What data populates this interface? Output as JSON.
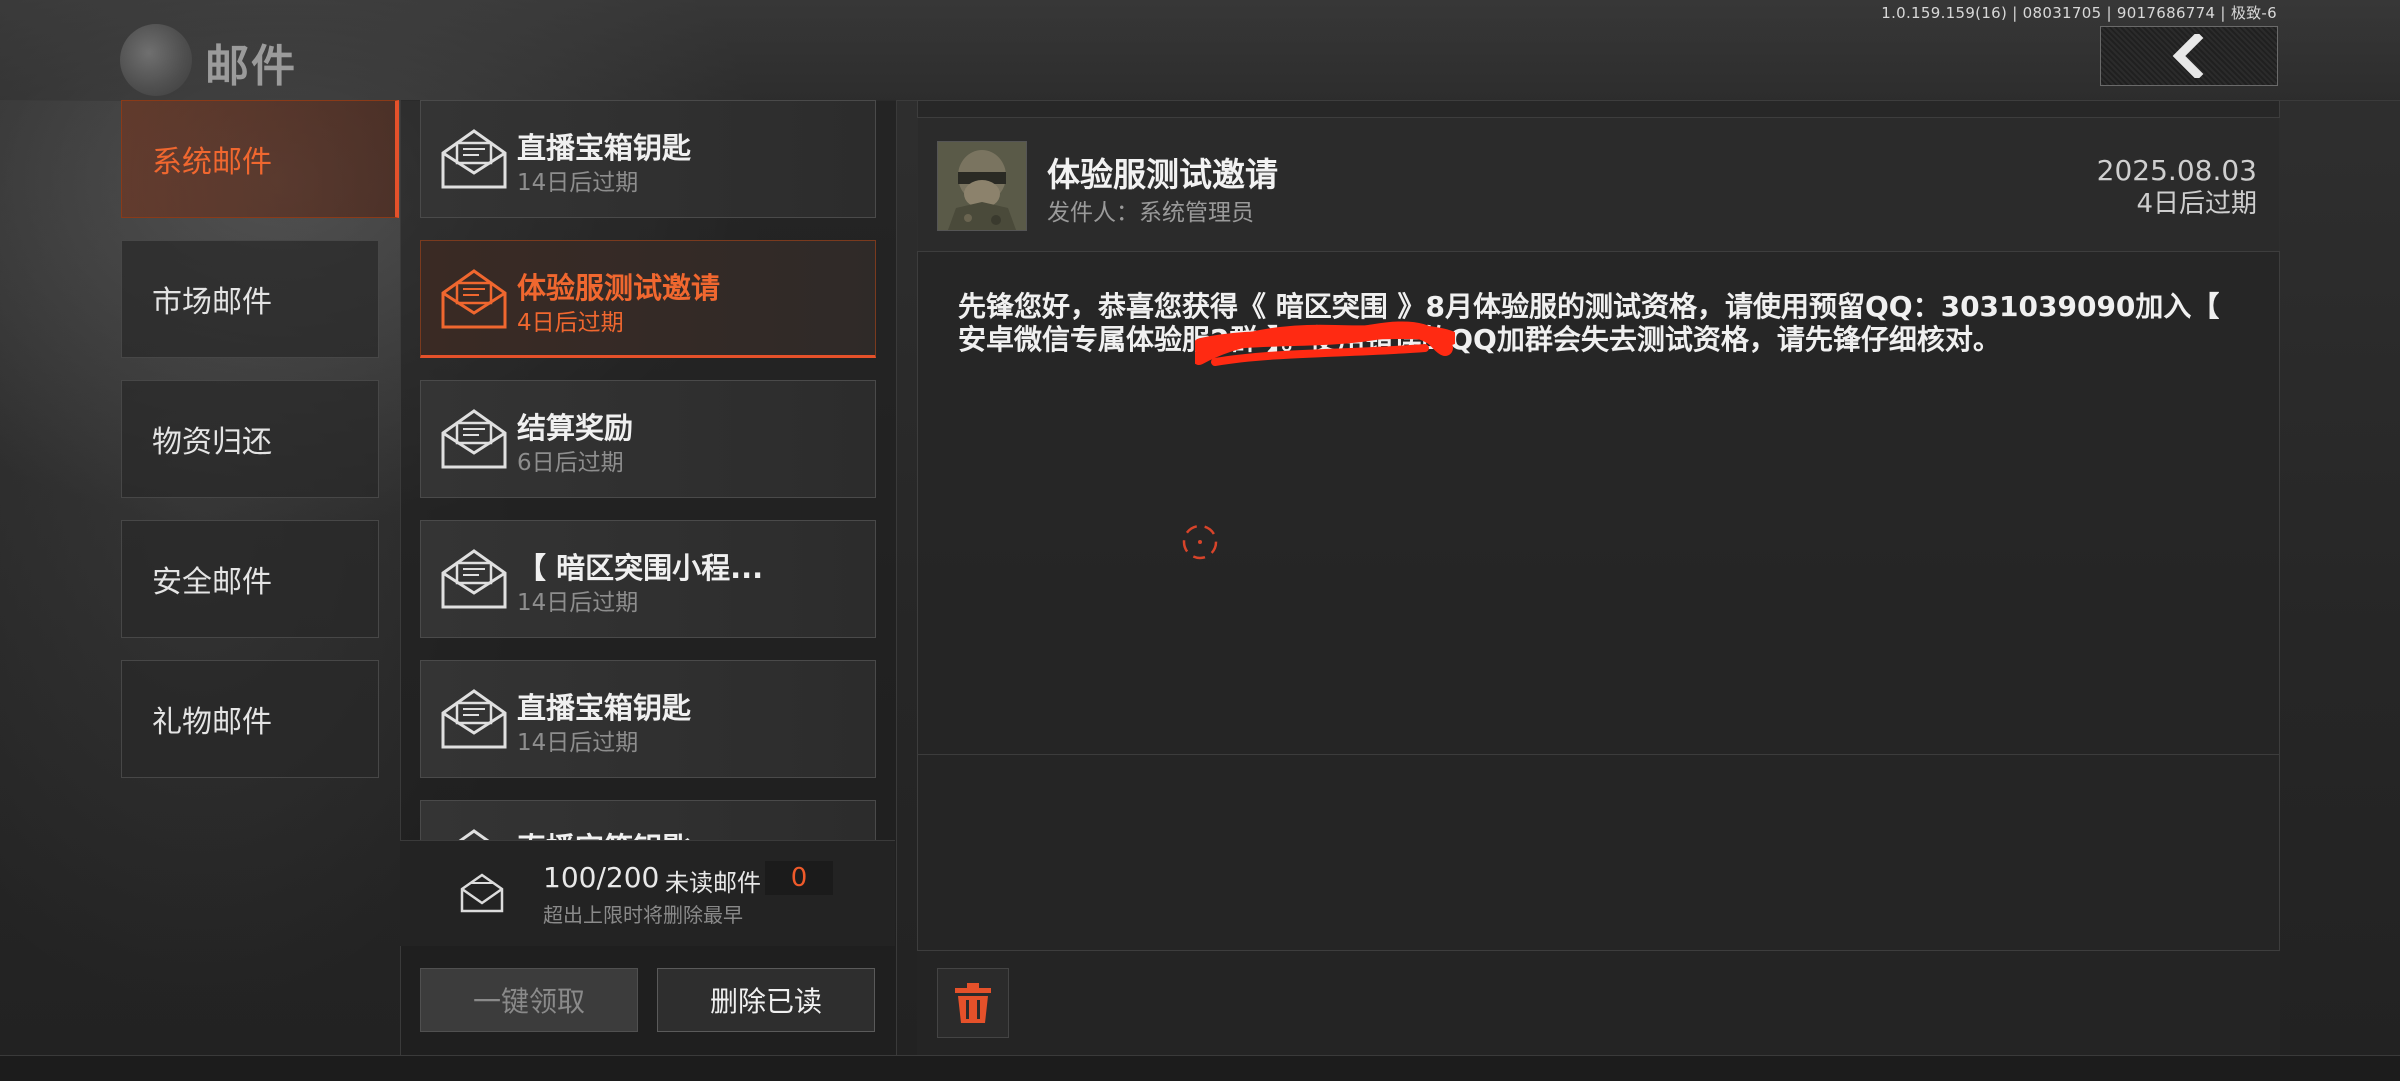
{
  "header": {
    "version_info": "1.0.159.159(16) | 08031705 | 9017686774 | 极致-6",
    "title": "邮件"
  },
  "categories": [
    {
      "label": "系统邮件",
      "active": true
    },
    {
      "label": "市场邮件",
      "active": false
    },
    {
      "label": "物资归还",
      "active": false
    },
    {
      "label": "安全邮件",
      "active": false
    },
    {
      "label": "礼物邮件",
      "active": false
    }
  ],
  "mails": [
    {
      "title": "直播宝箱钥匙",
      "expire": "14日后过期",
      "active": false
    },
    {
      "title": "体验服测试邀请",
      "expire": "4日后过期",
      "active": true
    },
    {
      "title": "结算奖励",
      "expire": "6日后过期",
      "active": false
    },
    {
      "title": "【 暗区突围小程...",
      "expire": "14日后过期",
      "active": false
    },
    {
      "title": "直播宝箱钥匙",
      "expire": "14日后过期",
      "active": false
    },
    {
      "title": "直播宝箱钥匙",
      "expire": "",
      "active": false
    }
  ],
  "summary": {
    "count": "100/200",
    "unread_label": "未读邮件",
    "unread_count": "0",
    "note": "超出上限时将删除最早"
  },
  "buttons": {
    "claim_all": "一键领取",
    "delete_read": "删除已读"
  },
  "detail": {
    "title": "体验服测试邀请",
    "sender": "发件人：系统管理员",
    "date": "2025.08.03",
    "expire": "4日后过期",
    "body": "先锋您好，恭喜您获得《 暗区突围 》8月体验服的测试资格，请使用预留QQ：3031039090加入【 安卓微信专属体验服2群                    】。使用错误的QQ加群会失去测试资格，请先锋仔细核对。"
  },
  "colors": {
    "accent": "#e5512a",
    "accent_text": "#f0672f"
  },
  "icons": {
    "back": "chevron-left-icon",
    "mail": "envelope-open-icon",
    "delete": "trash-icon",
    "loading": "loading-spinner-icon"
  }
}
